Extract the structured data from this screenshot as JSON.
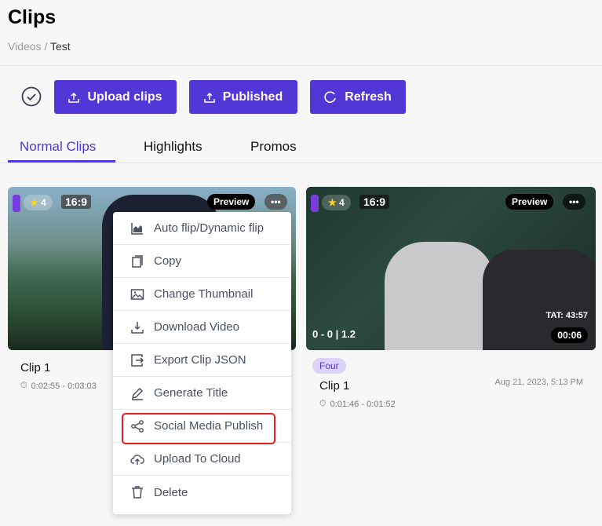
{
  "header": {
    "title": "Clips",
    "breadcrumb": [
      "Videos",
      "Test"
    ],
    "breadcrumb_sep": "/"
  },
  "toolbar": {
    "upload": "Upload clips",
    "published": "Published",
    "refresh": "Refresh"
  },
  "tabs": [
    {
      "label": "Normal Clips",
      "active": true
    },
    {
      "label": "Highlights"
    },
    {
      "label": "Promos"
    }
  ],
  "colors": {
    "accent": "#5236d6",
    "highlight": "#e02020"
  },
  "menu": [
    "Auto flip/Dynamic flip",
    "Copy",
    "Change Thumbnail",
    "Download Video",
    "Export Clip JSON",
    "Generate Title",
    "Social Media Publish",
    "Upload To Cloud",
    "Delete"
  ],
  "clips": [
    {
      "rating": "4",
      "aspect": "16:9",
      "preview": "Preview",
      "title": "Clip 1",
      "range": "0:02:55 - 0:03:03"
    },
    {
      "rating": "4",
      "aspect": "16:9",
      "preview": "Preview",
      "title": "Clip 1",
      "range": "0:01:46 - 0:01:52",
      "score": "0 - 0 | 1.2",
      "tat": "TAT: 43:57",
      "duration": "00:06",
      "tag": "Four",
      "date": "Aug 21, 2023, 5:13 PM"
    }
  ]
}
